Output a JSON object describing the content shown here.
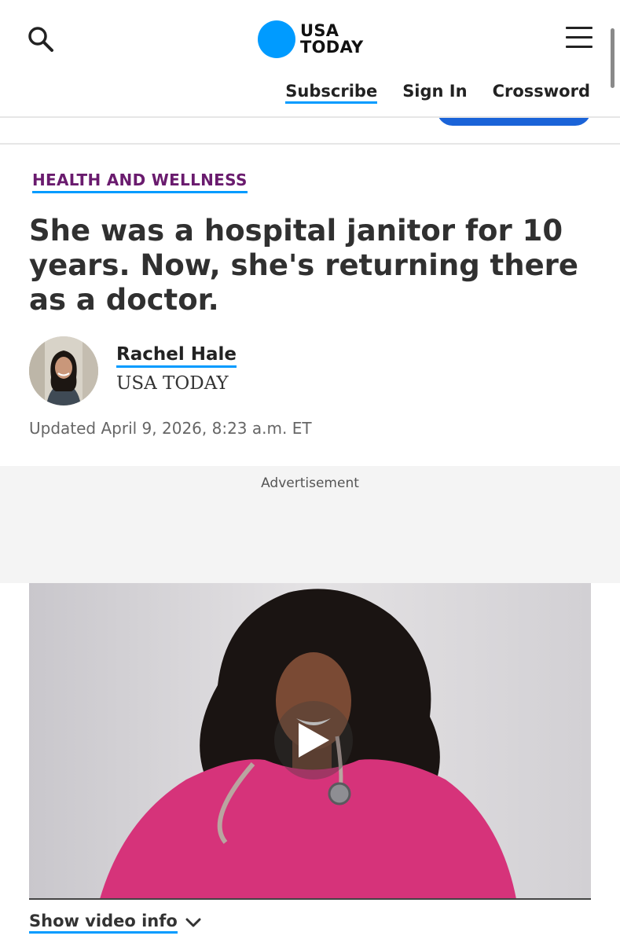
{
  "header": {
    "logo_line1": "USA",
    "logo_line2": "TODAY",
    "nav": {
      "subscribe": "Subscribe",
      "sign_in": "Sign In",
      "crossword": "Crossword"
    }
  },
  "article": {
    "category": "HEALTH AND WELLNESS",
    "headline": "She was a hospital janitor for 10 years. Now, she's returning there as a doctor.",
    "author": "Rachel Hale",
    "publication": "USA TODAY",
    "updated": "Updated April 9, 2026, 8:23 a.m. ET"
  },
  "advert": {
    "label": "Advertisement"
  },
  "video": {
    "show_info_label": "Show video info"
  },
  "colors": {
    "brand_blue": "#009bff",
    "category_purple": "#6a1b6e",
    "cta_blue": "#1a63d8"
  },
  "icons": [
    "search-icon",
    "menu-icon",
    "play-icon",
    "chevron-down-icon"
  ]
}
